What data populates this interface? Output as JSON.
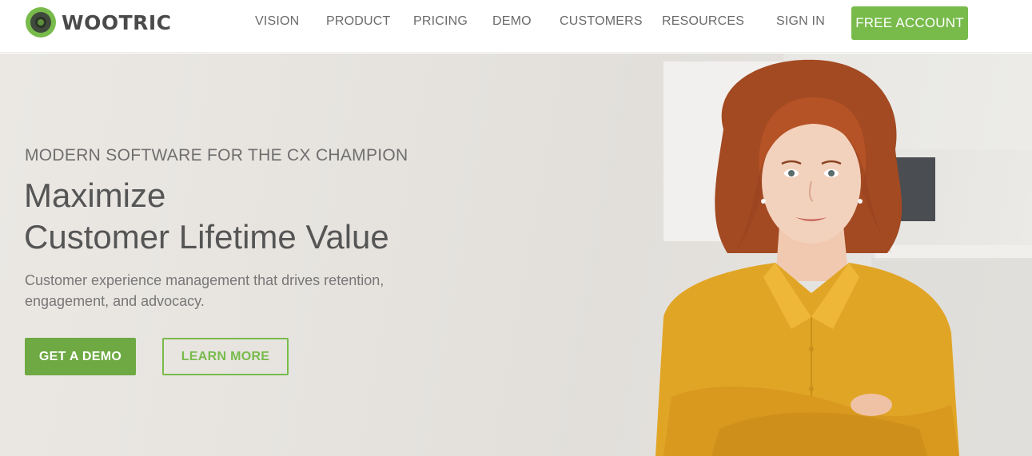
{
  "header": {
    "logo_text": "WOOTRIC",
    "nav": [
      {
        "label": "VISION",
        "name": "nav-vision"
      },
      {
        "label": "PRODUCT",
        "name": "nav-product"
      },
      {
        "label": "PRICING",
        "name": "nav-pricing"
      },
      {
        "label": "DEMO",
        "name": "nav-demo"
      },
      {
        "label": "CUSTOMERS",
        "name": "nav-customers"
      },
      {
        "label": "RESOURCES",
        "name": "nav-resources"
      },
      {
        "label": "SIGN IN",
        "name": "nav-sign-in"
      }
    ],
    "cta_label": "FREE ACCOUNT"
  },
  "hero": {
    "eyebrow": "MODERN SOFTWARE FOR THE CX CHAMPION",
    "headline_line1": "Maximize",
    "headline_line2": "Customer Lifetime Value",
    "subtext": "Customer experience management that drives retention, engagement, and advocacy.",
    "primary_button": "GET A DEMO",
    "secondary_button": "LEARN MORE"
  },
  "colors": {
    "brand_green": "#78bb4b",
    "button_green": "#6ea943",
    "logo_dark": "#4a4a4a",
    "text_gray": "#6e6e6e"
  },
  "icons": {
    "logo": "wootric-logo-mark"
  }
}
